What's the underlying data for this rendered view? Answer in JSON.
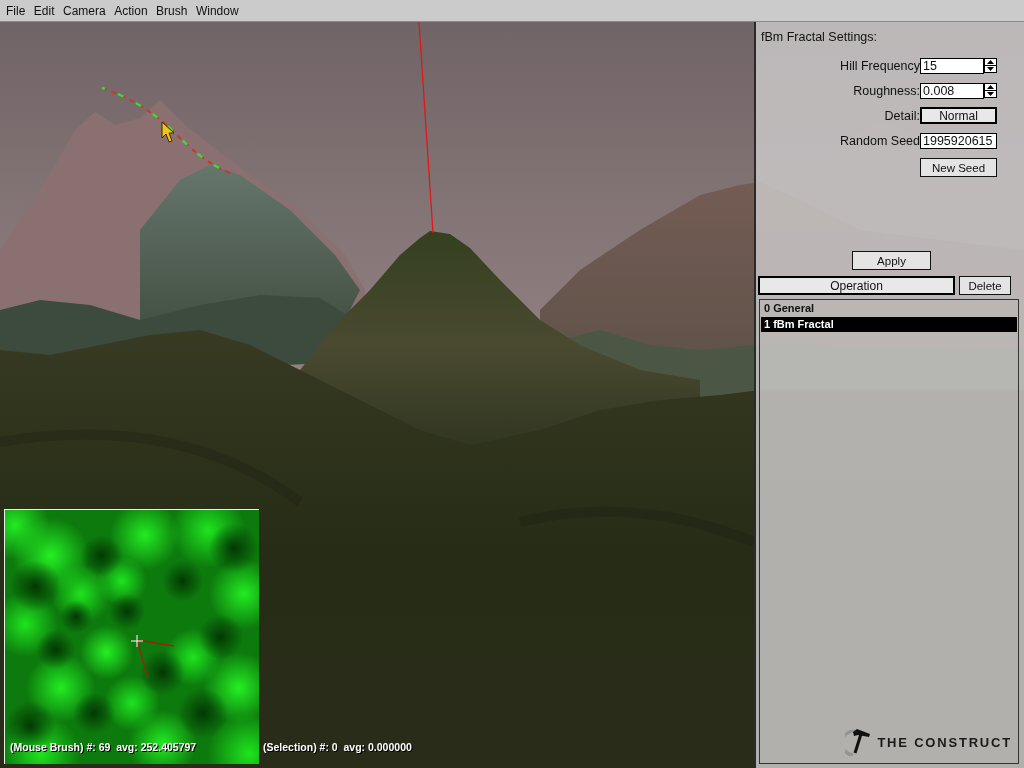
{
  "menu": [
    "File",
    "Edit",
    "Camera",
    "Action",
    "Brush",
    "Window"
  ],
  "viewport": {
    "mouse_brush_status": "(Mouse Brush) #: 69  avg: 252.405797",
    "selection_status": "(Selection) #: 0  avg: 0.000000"
  },
  "panel": {
    "title": "fBm Fractal Settings:",
    "fields": [
      {
        "kind": "spinner",
        "label": "Hill Frequency",
        "value": "15"
      },
      {
        "kind": "spinner",
        "label": "Roughness:",
        "value": "0.008"
      },
      {
        "kind": "dropdown",
        "label": "Detail:",
        "value": "Normal"
      },
      {
        "kind": "text",
        "label": "Random Seed",
        "value": "1995920615"
      }
    ],
    "new_seed_button": "New Seed",
    "apply_button": "Apply",
    "operation_dropdown": "Operation",
    "delete_button": "Delete",
    "operations": [
      {
        "label": "0 General",
        "selected": false
      },
      {
        "label": "1 fBm Fractal",
        "selected": true
      }
    ],
    "logo": "THE CONSTRUCT"
  }
}
